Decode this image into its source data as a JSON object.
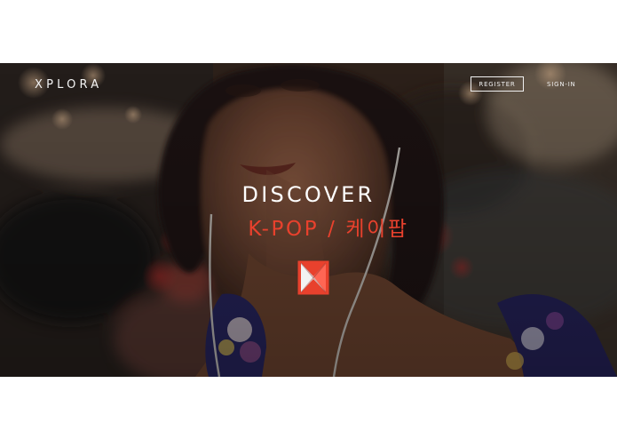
{
  "brand": {
    "logo_text": "XPLORA",
    "accent": "#e8412d"
  },
  "nav": {
    "register_label": "REGISTER",
    "signin_label": "SIGN-IN"
  },
  "hero": {
    "headline": "DISCOVER",
    "subline": "K-POP / 케이팝",
    "image_description": "woman with earphones listening to music"
  },
  "icons": {
    "brand_mark": "xplora-x-mark-icon"
  }
}
